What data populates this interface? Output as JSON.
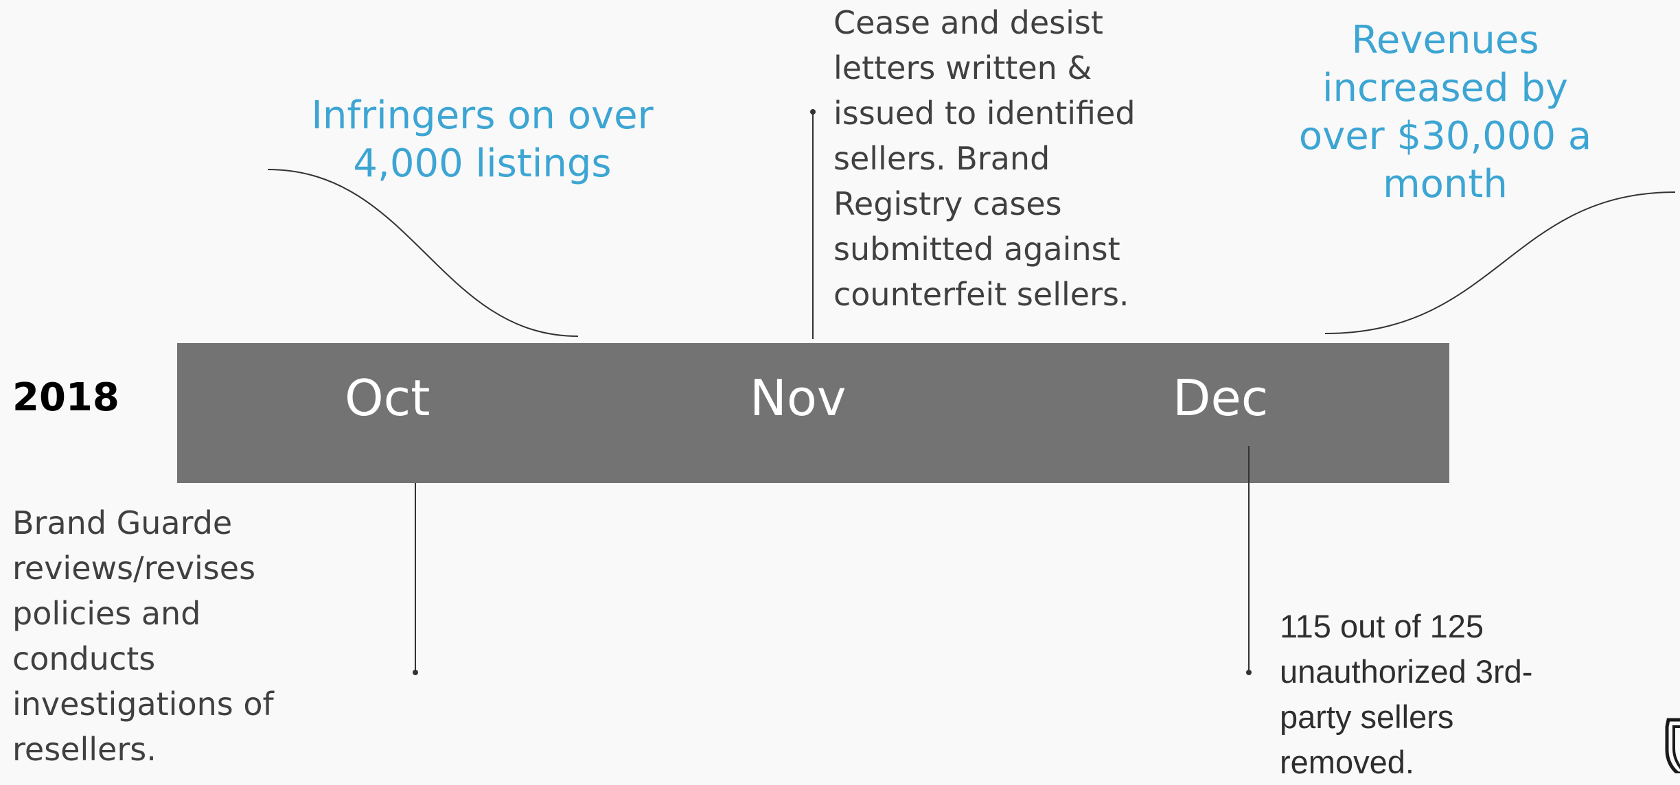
{
  "timeline": {
    "year": "2018",
    "months": [
      "Oct",
      "Nov",
      "Dec"
    ]
  },
  "callouts": {
    "infringers": "Infringers on over 4,000 listings",
    "cease_desist": "Cease and desist letters written & issued to identified sellers. Brand Registry cases submitted against counterfeit sellers.",
    "revenues": "Revenues increased by over $30,000 a month",
    "brand_guarde": "Brand Guarde reviews/revises policies and conducts investigations of resellers.",
    "sellers_removed": "115 out of 125 unauthorized 3rd-party sellers removed."
  },
  "colors": {
    "accent_blue": "#3ca5d3",
    "bar_gray": "#737373",
    "text_gray": "#404040",
    "background": "#f9f9f9"
  },
  "icons": {
    "corner_logo": "shield-icon"
  }
}
